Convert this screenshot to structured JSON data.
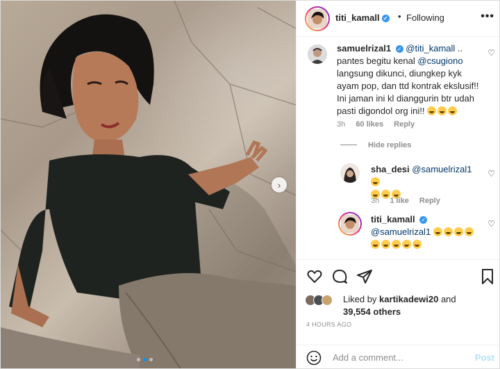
{
  "post": {
    "author": "titi_kamall",
    "separator": "•",
    "follow_status": "Following",
    "more_label": "•••"
  },
  "icons": {
    "verified": "verified-badge-icon",
    "heart": "heart-icon",
    "comment": "comment-icon",
    "share": "share-icon",
    "bookmark": "bookmark-icon",
    "emoji": "emoji-icon",
    "more": "more-options-icon",
    "carousel_next": "chevron-right-icon"
  },
  "colors": {
    "verified": "#3897f0",
    "mention": "#00376b",
    "post_disabled": "#b2dffc",
    "carousel_active": "#0095f6"
  },
  "comments": [
    {
      "user": "samuelrizal1",
      "mention": "@titi_kamall",
      "text_1": " ..\npantes begitu kenal ",
      "mention_2": "@csugiono",
      "text_2": "\nlangsung dikunci, diungkep kyk\nayam pop, dan ttd kontrak ekslusif!!\nIni jaman ini kl dianggurin btr udah\npasti digondol org ini!!",
      "emoji_count": 3,
      "time": "3h",
      "likes": "60 likes",
      "reply": "Reply"
    }
  ],
  "hide_replies": "Hide replies",
  "replies": [
    {
      "user": "sha_desi",
      "mention": "@samuelrizal1",
      "emoji_count_line1": 1,
      "emoji_count_line2": 3,
      "time": "3h",
      "likes": "1 like",
      "reply": "Reply"
    },
    {
      "user": "titi_kamall",
      "mention": "@samuelrizal1",
      "emoji_count_line1": 4,
      "emoji_count_line2": 5
    }
  ],
  "likes": {
    "prefix": "Liked by ",
    "user": "kartikadewi20",
    "mid": " and",
    "others": "39,554 others"
  },
  "timestamp": "4 HOURS AGO",
  "add_comment": {
    "placeholder": "Add a comment...",
    "post_label": "Post"
  },
  "carousel": {
    "slides": 3,
    "active_index": 1
  }
}
